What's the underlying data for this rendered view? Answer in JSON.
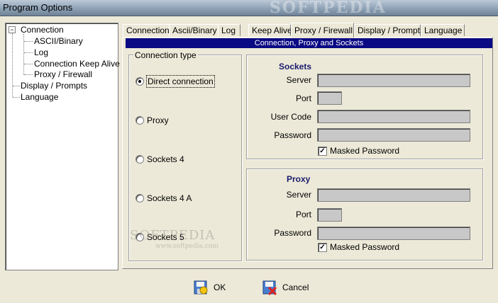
{
  "window": {
    "title": "Program Options",
    "watermark": "SOFTPEDIA"
  },
  "tree": {
    "items": [
      {
        "label": "Connection",
        "expander": "−"
      },
      {
        "label": "ASCII/Binary"
      },
      {
        "label": "Log"
      },
      {
        "label": "Connection Keep Alive"
      },
      {
        "label": "Proxy / Firewall"
      },
      {
        "label": "Display / Prompts"
      },
      {
        "label": "Language"
      }
    ]
  },
  "tabs": [
    {
      "label": "Connection"
    },
    {
      "label": "Ascii/Binary"
    },
    {
      "label": "Log"
    },
    {
      "label": "Keep Alive"
    },
    {
      "label": "Proxy / Firewall",
      "active": true
    },
    {
      "label": "Display / Prompts"
    },
    {
      "label": "Language"
    }
  ],
  "section_header": "Connection, Proxy and Sockets",
  "connection_type": {
    "title": "Connection type",
    "options": [
      {
        "label": "Direct connection",
        "checked": true
      },
      {
        "label": "Proxy",
        "checked": false
      },
      {
        "label": "Sockets 4",
        "checked": false
      },
      {
        "label": "Sockets 4 A",
        "checked": false
      },
      {
        "label": "Sockets 5",
        "checked": false
      }
    ]
  },
  "sockets": {
    "heading": "Sockets",
    "server_label": "Server",
    "port_label": "Port",
    "usercode_label": "User Code",
    "password_label": "Password",
    "masked_label": "Masked Password",
    "masked_checked": true,
    "server_value": "",
    "port_value": "",
    "usercode_value": "",
    "password_value": ""
  },
  "proxy": {
    "heading": "Proxy",
    "server_label": "Server",
    "port_label": "Port",
    "password_label": "Password",
    "masked_label": "Masked Password",
    "masked_checked": true,
    "server_value": "",
    "port_value": "",
    "password_value": ""
  },
  "buttons": {
    "ok": "OK",
    "cancel": "Cancel"
  },
  "watermark_bottom": {
    "brand": "SOFTPEDIA",
    "url": "www.softpedia.com"
  },
  "colors": {
    "header_bg": "#0a0a84",
    "field_bg": "#c8c8c8",
    "dialog_bg": "#ece9d8"
  }
}
